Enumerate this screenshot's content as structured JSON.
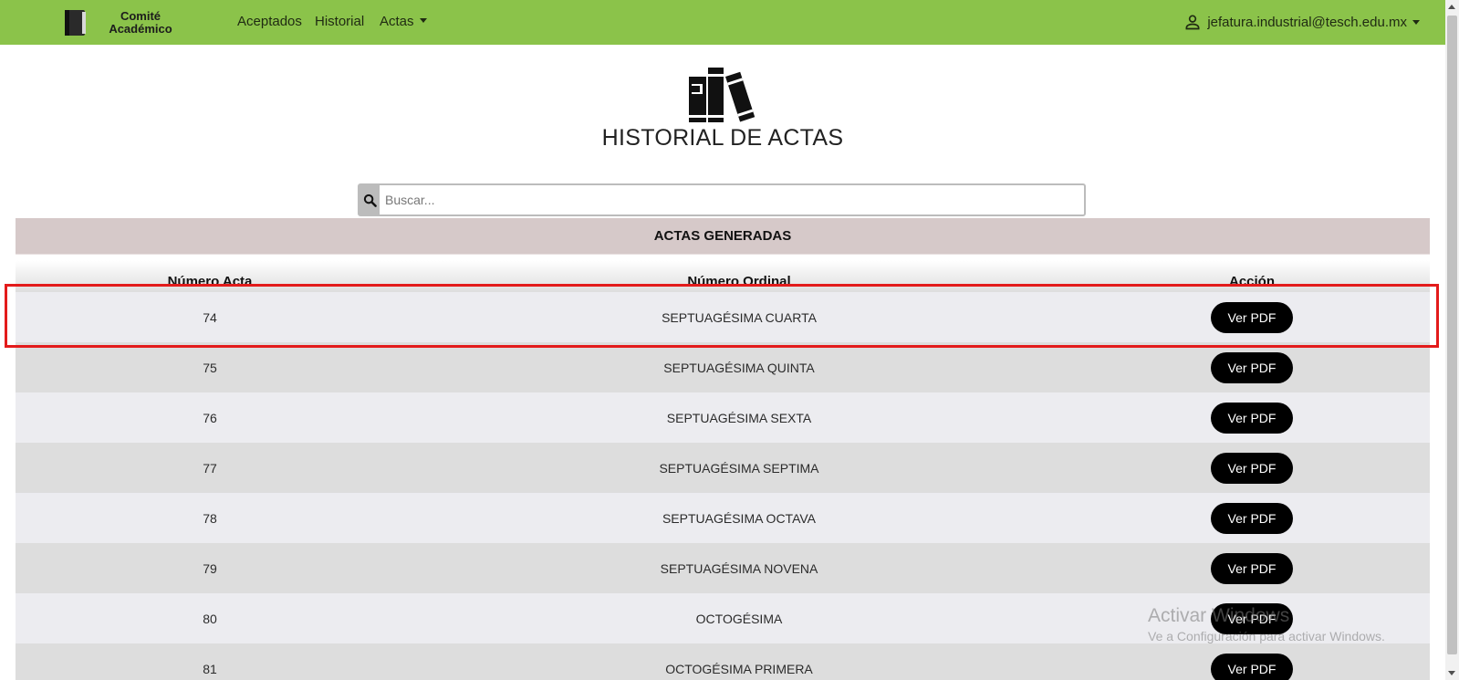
{
  "navbar": {
    "brand_line1": "Comité",
    "brand_line2": "Académico",
    "links": {
      "aceptados": "Aceptados",
      "historial": "Historial",
      "actas": "Actas"
    },
    "user_email": "jefatura.industrial@tesch.edu.mx",
    "color": "#8bc34a"
  },
  "page": {
    "title": "HISTORIAL DE ACTAS"
  },
  "search": {
    "placeholder": "Buscar...",
    "value": ""
  },
  "table": {
    "caption": "ACTAS GENERADAS",
    "headers": [
      "Número Acta",
      "Número Ordinal",
      "Acción"
    ],
    "button_label": "Ver PDF",
    "rows": [
      {
        "numero": "74",
        "ordinal": "SEPTUAGÉSIMA CUARTA"
      },
      {
        "numero": "75",
        "ordinal": "SEPTUAGÉSIMA QUINTA"
      },
      {
        "numero": "76",
        "ordinal": "SEPTUAGÉSIMA SEXTA"
      },
      {
        "numero": "77",
        "ordinal": "SEPTUAGÉSIMA SEPTIMA"
      },
      {
        "numero": "78",
        "ordinal": "SEPTUAGÉSIMA OCTAVA"
      },
      {
        "numero": "79",
        "ordinal": "SEPTUAGÉSIMA NOVENA"
      },
      {
        "numero": "80",
        "ordinal": "OCTOGÉSIMA"
      },
      {
        "numero": "81",
        "ordinal": "OCTOGÉSIMA PRIMERA"
      }
    ],
    "highlighted_row": "74"
  },
  "watermark": {
    "title": "Activar Windows",
    "subtitle": "Ve a Configuración para activar Windows."
  }
}
